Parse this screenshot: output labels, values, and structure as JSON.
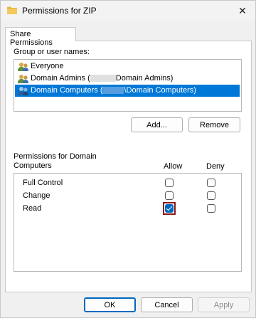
{
  "window": {
    "title": "Permissions for ZIP",
    "close_glyph": "✕"
  },
  "tab": {
    "label": "Share Permissions"
  },
  "group_list": {
    "label": "Group or user names:",
    "items": [
      {
        "name": "Everyone",
        "suffix": ""
      },
      {
        "name": "Domain Admins (",
        "suffix": "Domain Admins)"
      },
      {
        "name": "Domain Computers (",
        "suffix": "\\Domain Computers)",
        "selected": true
      }
    ]
  },
  "buttons": {
    "add": "Add...",
    "remove": "Remove",
    "ok": "OK",
    "cancel": "Cancel",
    "apply": "Apply"
  },
  "permissions": {
    "label_line1": "Permissions for Domain",
    "label_line2": "Computers",
    "col_allow": "Allow",
    "col_deny": "Deny",
    "rows": [
      {
        "name": "Full Control",
        "allow": false,
        "deny": false
      },
      {
        "name": "Change",
        "allow": false,
        "deny": false
      },
      {
        "name": "Read",
        "allow": true,
        "deny": false
      }
    ]
  },
  "colors": {
    "selection": "#0078d7",
    "accent": "#0067c0",
    "highlight_box": "#8b1a1a"
  }
}
